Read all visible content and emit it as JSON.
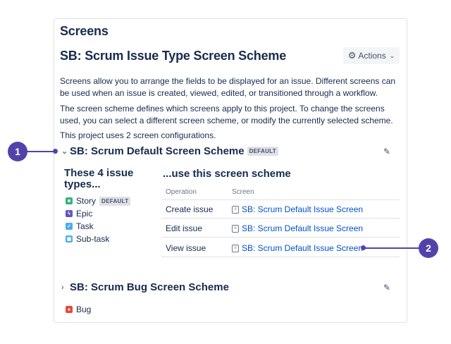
{
  "page": {
    "title": "Screens",
    "scheme_title": "SB: Scrum Issue Type Screen Scheme",
    "actions_label": "Actions",
    "description_1": "Screens allow you to arrange the fields to be displayed for an issue. Different screens can be used when an issue is created, viewed, edited, or transitioned through a workflow.",
    "description_2": "The screen scheme defines which screens apply to this project. To change the screens used, you can select a different screen scheme, or modify the currently selected scheme.",
    "config_count_text": "This project uses 2 screen configurations."
  },
  "schemes": [
    {
      "name": "SB: Scrum Default Screen Scheme",
      "badge": "DEFAULT",
      "types_heading": "These 4 issue types...",
      "use_heading": "...use this screen scheme",
      "issue_types": [
        {
          "name": "Story",
          "badge": "DEFAULT",
          "icon": "story-icon",
          "color": "#36b37e"
        },
        {
          "name": "Epic",
          "badge": "",
          "icon": "epic-icon",
          "color": "#6554c0"
        },
        {
          "name": "Task",
          "badge": "",
          "icon": "task-icon",
          "color": "#4bade8"
        },
        {
          "name": "Sub-task",
          "badge": "",
          "icon": "subtask-icon",
          "color": "#4bade8"
        }
      ],
      "table": {
        "headers": [
          "Operation",
          "Screen"
        ],
        "rows": [
          {
            "operation": "Create issue",
            "screen": "SB: Scrum Default Issue Screen"
          },
          {
            "operation": "Edit issue",
            "screen": "SB: Scrum Default Issue Screen"
          },
          {
            "operation": "View issue",
            "screen": "SB: Scrum Default Issue Screen"
          }
        ]
      }
    },
    {
      "name": "SB: Scrum Bug Screen Scheme",
      "issue_types": [
        {
          "name": "Bug",
          "icon": "bug-icon",
          "color": "#e5493a"
        }
      ]
    }
  ],
  "callouts": [
    "1",
    "2"
  ],
  "colors": {
    "accent": "#5243aa",
    "link": "#0052cc"
  }
}
